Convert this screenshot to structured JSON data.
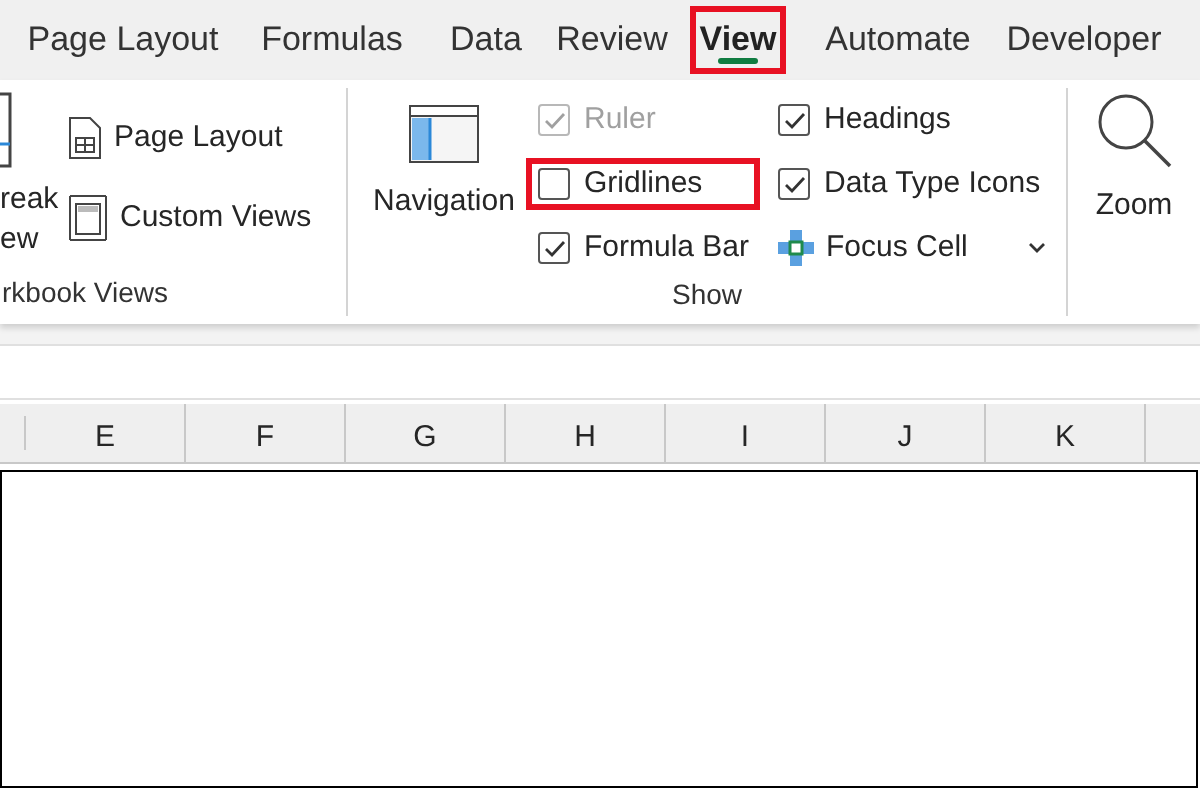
{
  "tabs": [
    {
      "label": "Page Layout",
      "selected": false,
      "highlighted": false
    },
    {
      "label": "Formulas",
      "selected": false,
      "highlighted": false
    },
    {
      "label": "Data",
      "selected": false,
      "highlighted": false
    },
    {
      "label": "Review",
      "selected": false,
      "highlighted": false
    },
    {
      "label": "View",
      "selected": true,
      "highlighted": true
    },
    {
      "label": "Automate",
      "selected": false,
      "highlighted": false
    },
    {
      "label": "Developer",
      "selected": false,
      "highlighted": false
    }
  ],
  "workbook_views": {
    "label": "rkbook Views",
    "page_break_preview": {
      "lines": [
        "reak",
        "ew"
      ]
    },
    "buttons": [
      {
        "kind": "page-layout",
        "label": "Page Layout"
      },
      {
        "kind": "custom-views",
        "label": "Custom Views"
      }
    ]
  },
  "show": {
    "label": "Show",
    "navigation": {
      "label": "Navigation"
    },
    "checkboxes": [
      {
        "label": "Ruler",
        "checked": true,
        "disabled": true,
        "highlighted": false
      },
      {
        "label": "Gridlines",
        "checked": false,
        "disabled": false,
        "highlighted": true
      },
      {
        "label": "Formula Bar",
        "checked": true,
        "disabled": false,
        "highlighted": false
      },
      {
        "label": "Headings",
        "checked": true,
        "disabled": false,
        "highlighted": false
      },
      {
        "label": "Data Type Icons",
        "checked": true,
        "disabled": false,
        "highlighted": false
      }
    ],
    "focus_cell": {
      "label": "Focus Cell"
    }
  },
  "zoom": {
    "label": "Zoom"
  },
  "columns": [
    "E",
    "F",
    "G",
    "H",
    "I",
    "J",
    "K"
  ]
}
